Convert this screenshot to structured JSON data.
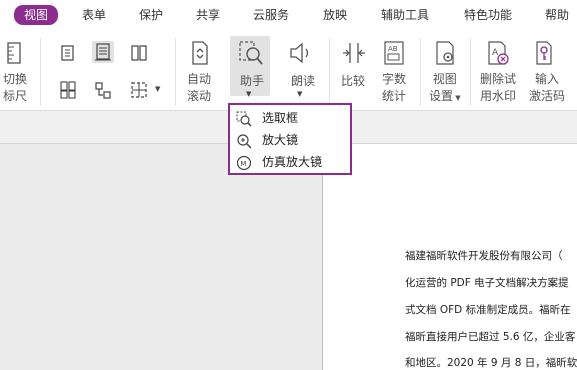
{
  "tabs": [
    {
      "label": "视图",
      "active": true
    },
    {
      "label": "表单"
    },
    {
      "label": "保护"
    },
    {
      "label": "共享"
    },
    {
      "label": "云服务"
    },
    {
      "label": "放映"
    },
    {
      "label": "辅助工具"
    },
    {
      "label": "特色功能"
    },
    {
      "label": "帮助"
    }
  ],
  "ribbon": {
    "switch_ruler": [
      "切换",
      "标尺"
    ],
    "auto_scroll": [
      "自动",
      "滚动"
    ],
    "assistant": "助手",
    "read_aloud": "朗读",
    "compare": "比较",
    "word_count": [
      "字数",
      "统计"
    ],
    "view_settings": [
      "视图",
      "设置"
    ],
    "remove_watermark": [
      "删除试",
      "用水印"
    ],
    "activation_code": [
      "输入",
      "激活码"
    ]
  },
  "dropdown": {
    "items": [
      "选取框",
      "放大镜",
      "仿真放大镜"
    ]
  },
  "document": {
    "lines": [
      "福建福昕软件开发股份有限公司（",
      "化运营的 PDF 电子文档解决方案提",
      "式文档 OFD 标准制定成员。福昕在",
      "福昕直接用户已超过 5.6 亿，企业客",
      "和地区。2020 年 9 月 8 日，福昕软"
    ]
  },
  "colors": {
    "accent": "#8a2d8e",
    "ribbon_bg": "#ffffff",
    "workspace_bg": "#ececec"
  }
}
